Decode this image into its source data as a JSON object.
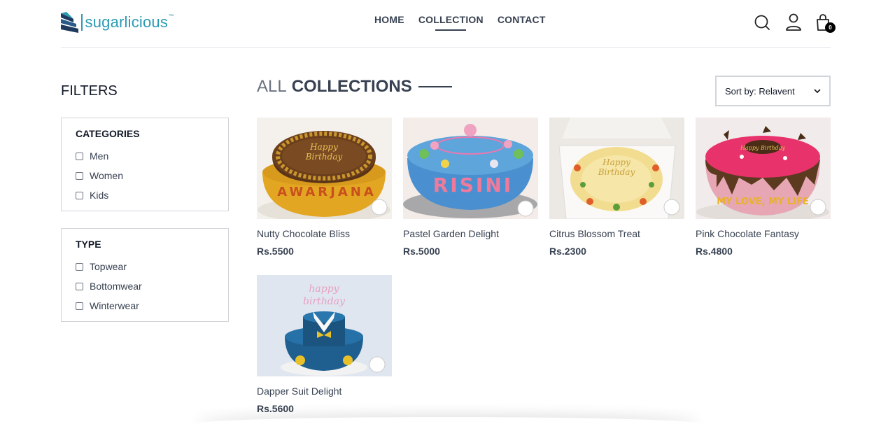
{
  "brand": {
    "name": "sugarlicious",
    "tm": "™",
    "color": "#2a9bb5"
  },
  "nav": [
    {
      "label": "HOME"
    },
    {
      "label": "COLLECTION",
      "active": true
    },
    {
      "label": "CONTACT"
    }
  ],
  "header_icons": [
    "search-icon",
    "user-icon",
    "cart-icon"
  ],
  "cart": {
    "count": "0"
  },
  "filters": {
    "title": "FILTERS",
    "categories": {
      "heading": "CATEGORIES",
      "options": [
        "Men",
        "Women",
        "Kids"
      ]
    },
    "type": {
      "heading": "TYPE",
      "options": [
        "Topwear",
        "Bottomwear",
        "Winterwear"
      ]
    }
  },
  "collection": {
    "title_light": "ALL",
    "title_bold": "COLLECTIONS",
    "sort_label": "Sort by: Relavent"
  },
  "products": [
    {
      "name": "Nutty Chocolate Bliss",
      "price": "Rs.5500",
      "image": "chocolate-cake-with-yellow-base"
    },
    {
      "name": "Pastel Garden Delight",
      "price": "Rs.5000",
      "image": "blue-cake-with-flowers"
    },
    {
      "name": "Citrus Blossom Treat",
      "price": "Rs.2300",
      "image": "cream-cake-in-box"
    },
    {
      "name": "Pink Chocolate Fantasy",
      "price": "Rs.4800",
      "image": "pink-drip-cake"
    },
    {
      "name": "Dapper Suit Delight",
      "price": "Rs.5600",
      "image": "blue-suit-cake"
    }
  ]
}
